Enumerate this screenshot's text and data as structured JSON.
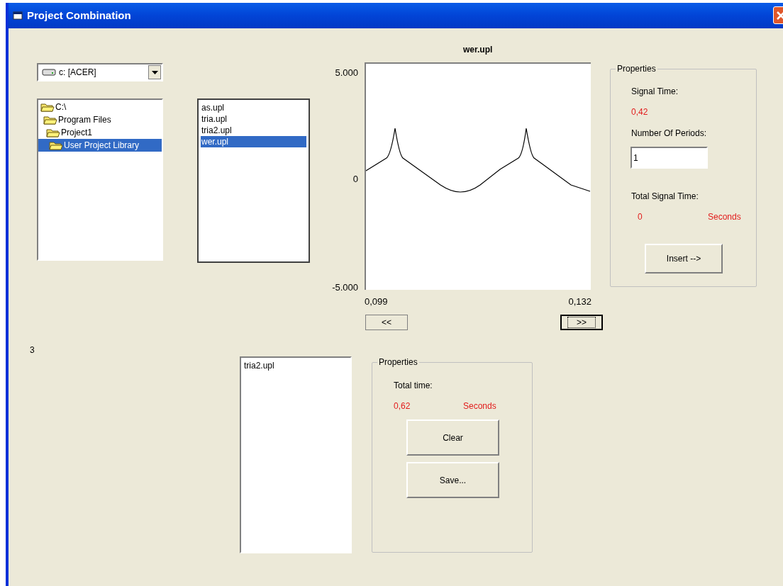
{
  "window": {
    "title": "Project Combination"
  },
  "drive_combo": {
    "value": "c: [ACER]"
  },
  "folder_tree": [
    {
      "label": "C:\\",
      "selected": false,
      "children": [
        {
          "label": "Program Files",
          "selected": false,
          "children": [
            {
              "label": "Project1",
              "selected": false,
              "children": [
                {
                  "label": "User Project Library",
                  "selected": true
                }
              ]
            }
          ]
        }
      ]
    }
  ],
  "file_list": [
    {
      "label": "as.upl",
      "selected": false
    },
    {
      "label": "tria.upl",
      "selected": false
    },
    {
      "label": "tria2.upl",
      "selected": false
    },
    {
      "label": "wer.upl",
      "selected": true
    }
  ],
  "plot": {
    "title": "wer.upl",
    "y_labels": [
      "5.000",
      "0",
      "-5.000"
    ],
    "x_labels": [
      "0,099",
      "0,132"
    ]
  },
  "scroll_buttons": [
    {
      "label": "<<",
      "focused": false
    },
    {
      "label": ">>",
      "focused": true
    }
  ],
  "signal_properties": {
    "title": "Properties",
    "signal_time_label": "Signal Time:",
    "signal_time": "0,42",
    "periods_label": "Number Of Periods:",
    "periods_value": "1",
    "total_label": "Total Signal Time:",
    "total_value": "0",
    "total_unit": "Seconds",
    "button": "Insert -->"
  },
  "count": "3",
  "combination_list": [
    {
      "label": "tria2.upl",
      "selected": false
    }
  ],
  "combination_properties": {
    "title": "Properties",
    "total_label": "Total time:",
    "total_value": "0,62",
    "total_unit": "Seconds",
    "buttons": [
      "Clear",
      "Save..."
    ]
  }
}
